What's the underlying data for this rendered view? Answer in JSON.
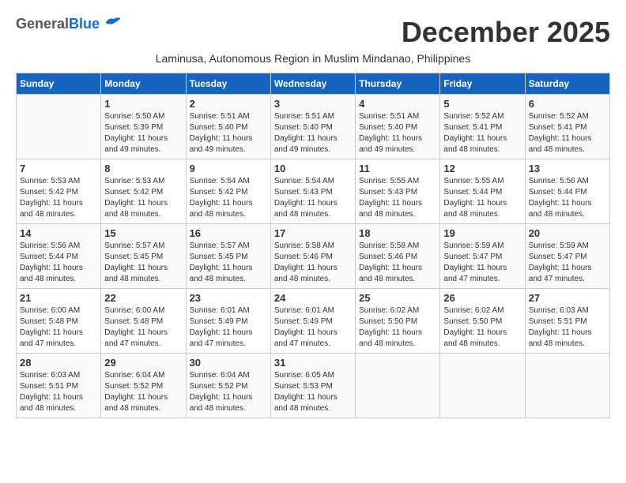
{
  "header": {
    "logo_general": "General",
    "logo_blue": "Blue",
    "month_year": "December 2025",
    "subtitle": "Laminusa, Autonomous Region in Muslim Mindanao, Philippines"
  },
  "days_of_week": [
    "Sunday",
    "Monday",
    "Tuesday",
    "Wednesday",
    "Thursday",
    "Friday",
    "Saturday"
  ],
  "weeks": [
    [
      {
        "day": "",
        "sunrise": "",
        "sunset": "",
        "daylight": ""
      },
      {
        "day": "1",
        "sunrise": "Sunrise: 5:50 AM",
        "sunset": "Sunset: 5:39 PM",
        "daylight": "Daylight: 11 hours and 49 minutes."
      },
      {
        "day": "2",
        "sunrise": "Sunrise: 5:51 AM",
        "sunset": "Sunset: 5:40 PM",
        "daylight": "Daylight: 11 hours and 49 minutes."
      },
      {
        "day": "3",
        "sunrise": "Sunrise: 5:51 AM",
        "sunset": "Sunset: 5:40 PM",
        "daylight": "Daylight: 11 hours and 49 minutes."
      },
      {
        "day": "4",
        "sunrise": "Sunrise: 5:51 AM",
        "sunset": "Sunset: 5:40 PM",
        "daylight": "Daylight: 11 hours and 49 minutes."
      },
      {
        "day": "5",
        "sunrise": "Sunrise: 5:52 AM",
        "sunset": "Sunset: 5:41 PM",
        "daylight": "Daylight: 11 hours and 48 minutes."
      },
      {
        "day": "6",
        "sunrise": "Sunrise: 5:52 AM",
        "sunset": "Sunset: 5:41 PM",
        "daylight": "Daylight: 11 hours and 48 minutes."
      }
    ],
    [
      {
        "day": "7",
        "sunrise": "Sunrise: 5:53 AM",
        "sunset": "Sunset: 5:42 PM",
        "daylight": "Daylight: 11 hours and 48 minutes."
      },
      {
        "day": "8",
        "sunrise": "Sunrise: 5:53 AM",
        "sunset": "Sunset: 5:42 PM",
        "daylight": "Daylight: 11 hours and 48 minutes."
      },
      {
        "day": "9",
        "sunrise": "Sunrise: 5:54 AM",
        "sunset": "Sunset: 5:42 PM",
        "daylight": "Daylight: 11 hours and 48 minutes."
      },
      {
        "day": "10",
        "sunrise": "Sunrise: 5:54 AM",
        "sunset": "Sunset: 5:43 PM",
        "daylight": "Daylight: 11 hours and 48 minutes."
      },
      {
        "day": "11",
        "sunrise": "Sunrise: 5:55 AM",
        "sunset": "Sunset: 5:43 PM",
        "daylight": "Daylight: 11 hours and 48 minutes."
      },
      {
        "day": "12",
        "sunrise": "Sunrise: 5:55 AM",
        "sunset": "Sunset: 5:44 PM",
        "daylight": "Daylight: 11 hours and 48 minutes."
      },
      {
        "day": "13",
        "sunrise": "Sunrise: 5:56 AM",
        "sunset": "Sunset: 5:44 PM",
        "daylight": "Daylight: 11 hours and 48 minutes."
      }
    ],
    [
      {
        "day": "14",
        "sunrise": "Sunrise: 5:56 AM",
        "sunset": "Sunset: 5:44 PM",
        "daylight": "Daylight: 11 hours and 48 minutes."
      },
      {
        "day": "15",
        "sunrise": "Sunrise: 5:57 AM",
        "sunset": "Sunset: 5:45 PM",
        "daylight": "Daylight: 11 hours and 48 minutes."
      },
      {
        "day": "16",
        "sunrise": "Sunrise: 5:57 AM",
        "sunset": "Sunset: 5:45 PM",
        "daylight": "Daylight: 11 hours and 48 minutes."
      },
      {
        "day": "17",
        "sunrise": "Sunrise: 5:58 AM",
        "sunset": "Sunset: 5:46 PM",
        "daylight": "Daylight: 11 hours and 48 minutes."
      },
      {
        "day": "18",
        "sunrise": "Sunrise: 5:58 AM",
        "sunset": "Sunset: 5:46 PM",
        "daylight": "Daylight: 11 hours and 48 minutes."
      },
      {
        "day": "19",
        "sunrise": "Sunrise: 5:59 AM",
        "sunset": "Sunset: 5:47 PM",
        "daylight": "Daylight: 11 hours and 47 minutes."
      },
      {
        "day": "20",
        "sunrise": "Sunrise: 5:59 AM",
        "sunset": "Sunset: 5:47 PM",
        "daylight": "Daylight: 11 hours and 47 minutes."
      }
    ],
    [
      {
        "day": "21",
        "sunrise": "Sunrise: 6:00 AM",
        "sunset": "Sunset: 5:48 PM",
        "daylight": "Daylight: 11 hours and 47 minutes."
      },
      {
        "day": "22",
        "sunrise": "Sunrise: 6:00 AM",
        "sunset": "Sunset: 5:48 PM",
        "daylight": "Daylight: 11 hours and 47 minutes."
      },
      {
        "day": "23",
        "sunrise": "Sunrise: 6:01 AM",
        "sunset": "Sunset: 5:49 PM",
        "daylight": "Daylight: 11 hours and 47 minutes."
      },
      {
        "day": "24",
        "sunrise": "Sunrise: 6:01 AM",
        "sunset": "Sunset: 5:49 PM",
        "daylight": "Daylight: 11 hours and 47 minutes."
      },
      {
        "day": "25",
        "sunrise": "Sunrise: 6:02 AM",
        "sunset": "Sunset: 5:50 PM",
        "daylight": "Daylight: 11 hours and 48 minutes."
      },
      {
        "day": "26",
        "sunrise": "Sunrise: 6:02 AM",
        "sunset": "Sunset: 5:50 PM",
        "daylight": "Daylight: 11 hours and 48 minutes."
      },
      {
        "day": "27",
        "sunrise": "Sunrise: 6:03 AM",
        "sunset": "Sunset: 5:51 PM",
        "daylight": "Daylight: 11 hours and 48 minutes."
      }
    ],
    [
      {
        "day": "28",
        "sunrise": "Sunrise: 6:03 AM",
        "sunset": "Sunset: 5:51 PM",
        "daylight": "Daylight: 11 hours and 48 minutes."
      },
      {
        "day": "29",
        "sunrise": "Sunrise: 6:04 AM",
        "sunset": "Sunset: 5:52 PM",
        "daylight": "Daylight: 11 hours and 48 minutes."
      },
      {
        "day": "30",
        "sunrise": "Sunrise: 6:04 AM",
        "sunset": "Sunset: 5:52 PM",
        "daylight": "Daylight: 11 hours and 48 minutes."
      },
      {
        "day": "31",
        "sunrise": "Sunrise: 6:05 AM",
        "sunset": "Sunset: 5:53 PM",
        "daylight": "Daylight: 11 hours and 48 minutes."
      },
      {
        "day": "",
        "sunrise": "",
        "sunset": "",
        "daylight": ""
      },
      {
        "day": "",
        "sunrise": "",
        "sunset": "",
        "daylight": ""
      },
      {
        "day": "",
        "sunrise": "",
        "sunset": "",
        "daylight": ""
      }
    ]
  ]
}
